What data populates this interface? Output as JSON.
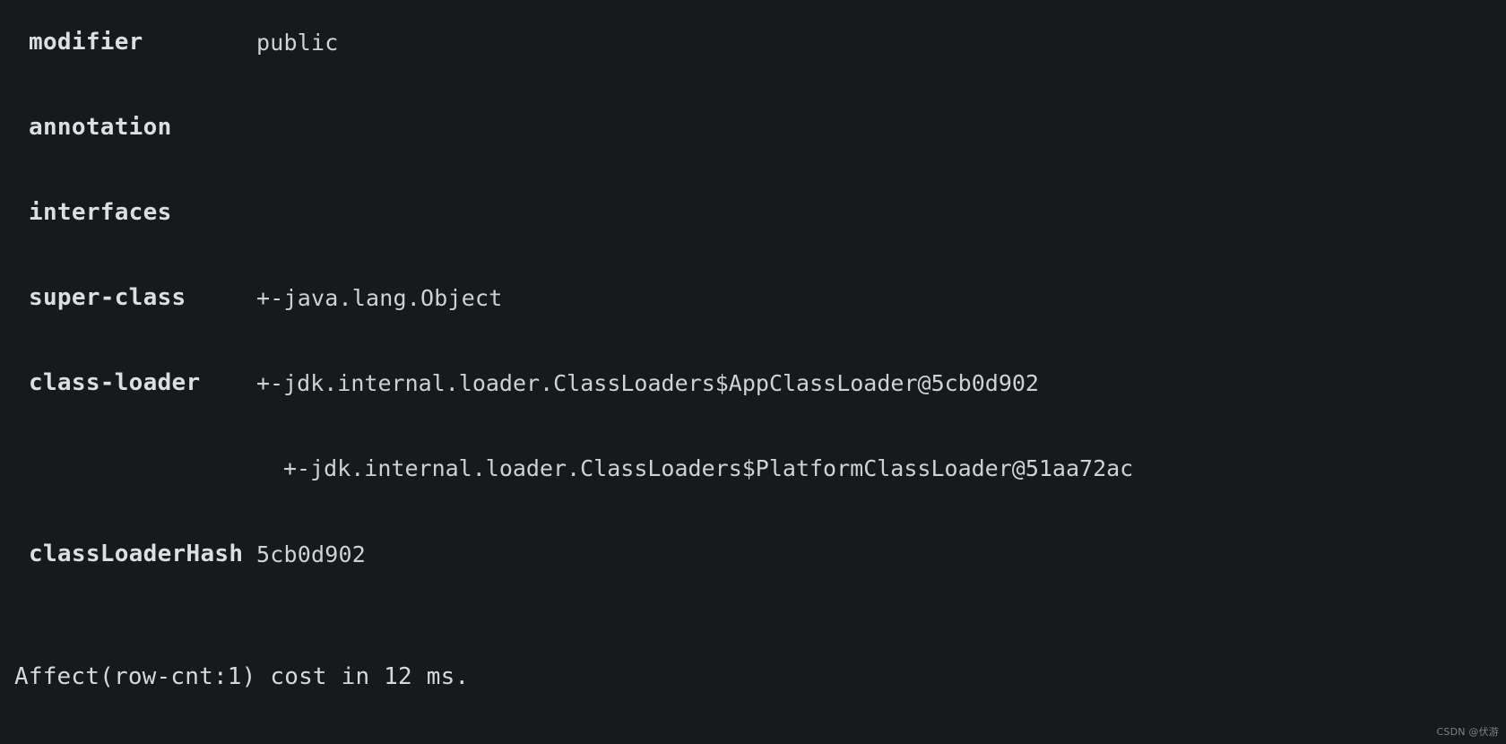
{
  "terminal": {
    "background_color": "#17191b",
    "text_color": "#d4d6d8",
    "rows": [
      {
        "label": "modifier",
        "value": "public"
      },
      {
        "label": "annotation",
        "value": ""
      },
      {
        "label": "interfaces",
        "value": ""
      },
      {
        "label": "super-class",
        "value": "+-java.lang.Object"
      }
    ],
    "class_loader": {
      "label": "class-loader",
      "lines": [
        "+-jdk.internal.loader.ClassLoaders$AppClassLoader@5cb0d902",
        "+-jdk.internal.loader.ClassLoaders$PlatformClassLoader@51aa72ac"
      ]
    },
    "class_loader_hash": {
      "label": "classLoaderHash",
      "value": "5cb0d902"
    },
    "status": "Affect(row-cnt:1) cost in 12 ms.",
    "watermark": "CSDN @伏游"
  }
}
